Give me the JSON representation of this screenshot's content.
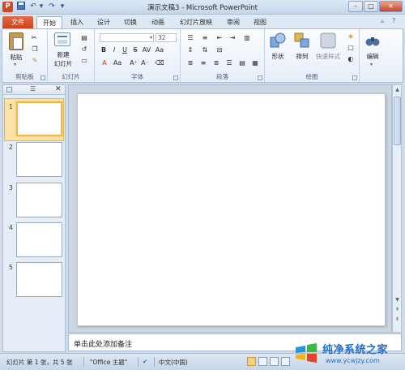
{
  "window": {
    "title": "演示文稿3 - Microsoft PowerPoint",
    "app_icon": "P",
    "controls": [
      "minimize",
      "maximize",
      "close"
    ]
  },
  "quick_access": [
    "save-icon",
    "undo-icon",
    "redo-icon",
    "customize-icon"
  ],
  "tabs": [
    {
      "label": "文件",
      "kind": "file"
    },
    {
      "label": "开始",
      "active": true
    },
    {
      "label": "插入"
    },
    {
      "label": "设计"
    },
    {
      "label": "切换"
    },
    {
      "label": "动画"
    },
    {
      "label": "幻灯片放映"
    },
    {
      "label": "审阅"
    },
    {
      "label": "视图"
    }
  ],
  "ribbon": {
    "clipboard": {
      "label": "剪贴板",
      "paste": "粘贴"
    },
    "slides": {
      "label": "幻灯片",
      "new_slide_line1": "新建",
      "new_slide_line2": "幻灯片"
    },
    "font": {
      "label": "字体",
      "font_name": "",
      "font_size": "32"
    },
    "paragraph": {
      "label": "段落"
    },
    "drawing": {
      "label": "绘图",
      "shapes": "形状",
      "arrange": "排列",
      "quick_styles": "快速样式"
    },
    "editing": {
      "label": "编辑"
    }
  },
  "thumbnails": {
    "slides": [
      {
        "number": "1",
        "selected": true
      },
      {
        "number": "2"
      },
      {
        "number": "3"
      },
      {
        "number": "4"
      },
      {
        "number": "5"
      }
    ]
  },
  "notes": {
    "placeholder": "单击此处添加备注"
  },
  "status": {
    "slide_info": "幻灯片 第 1 张，共 5 张",
    "theme": "\"Office 主题\"",
    "language": "中文(中国)"
  },
  "watermark": {
    "title": "纯净系统之家",
    "url": "www.ycwjzy.com"
  },
  "colors": {
    "file_tab": "#d24726",
    "selection": "#f3b548",
    "accent": "#1f6fc5"
  }
}
